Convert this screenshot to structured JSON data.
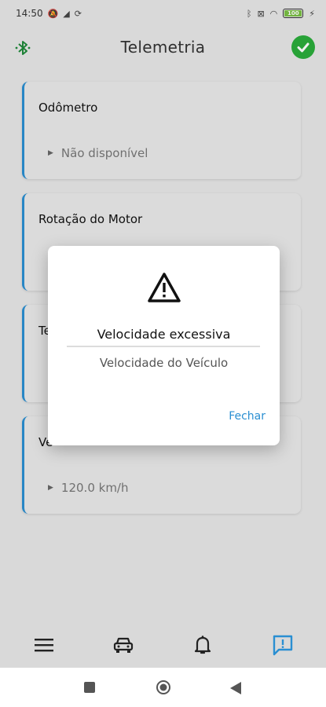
{
  "status_bar": {
    "time": "14:50",
    "battery_level": "100",
    "battery_percent": 100
  },
  "header": {
    "title": "Telemetria",
    "left_icon": "bluetooth-icon",
    "right_icon": "check-circle-icon"
  },
  "cards": [
    {
      "title": "Odômetro",
      "value": "Não disponível"
    },
    {
      "title": "Rotação do Motor",
      "value": ""
    },
    {
      "title": "Te",
      "value": ""
    },
    {
      "title": "Ve",
      "value": "120.0 km/h"
    }
  ],
  "dialog": {
    "icon": "warning-icon",
    "title": "Velocidade excessiva",
    "subtitle": "Velocidade do Veículo",
    "close_label": "Fechar"
  },
  "bottom_nav": {
    "items": [
      "menu-icon",
      "car-icon",
      "bell-icon",
      "alert-message-icon"
    ],
    "active": "alert-message-icon"
  },
  "colors": {
    "accent": "#2a8fd2",
    "success": "#2bad3b",
    "bluetooth": "#1f8a3a"
  }
}
